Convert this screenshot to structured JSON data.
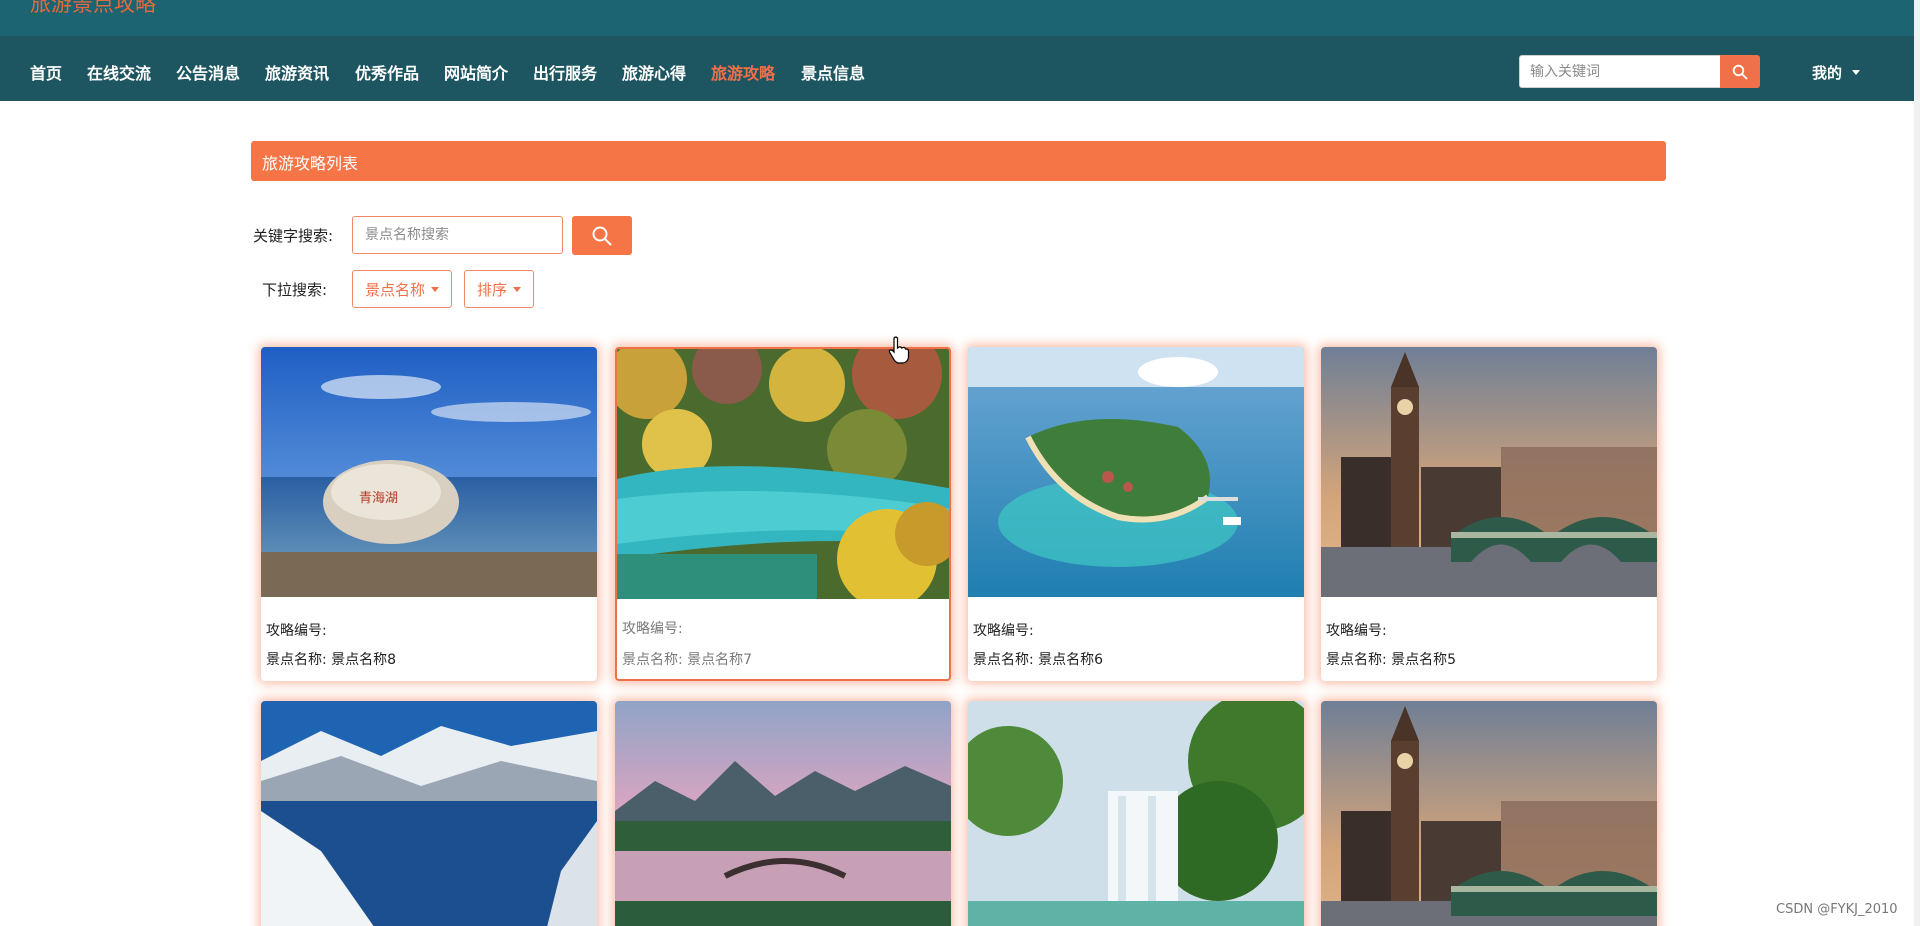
{
  "site": {
    "title": "旅游景点攻略"
  },
  "nav": {
    "items": [
      {
        "label": "首页"
      },
      {
        "label": "在线交流"
      },
      {
        "label": "公告消息"
      },
      {
        "label": "旅游资讯"
      },
      {
        "label": "优秀作品"
      },
      {
        "label": "网站简介"
      },
      {
        "label": "出行服务"
      },
      {
        "label": "旅游心得"
      },
      {
        "label": "旅游攻略",
        "active": true
      },
      {
        "label": "景点信息"
      }
    ],
    "search_placeholder": "输入关键词",
    "user_menu": "我的"
  },
  "page": {
    "title": "旅游攻略列表",
    "keyword_label": "关键字搜索:",
    "keyword_placeholder": "景点名称搜索",
    "dropdown_label": "下拉搜索:",
    "dropdowns": [
      {
        "label": "景点名称"
      },
      {
        "label": "排序"
      }
    ]
  },
  "cards": [
    {
      "scene": "lake-rock",
      "id_label": "攻略编号:",
      "name_label": "景点名称:",
      "name": "景点名称8"
    },
    {
      "scene": "autumn-forest-lake",
      "id_label": "攻略编号:",
      "name_label": "景点名称:",
      "name": "景点名称7"
    },
    {
      "scene": "tropical-island",
      "id_label": "攻略编号:",
      "name_label": "景点名称:",
      "name": "景点名称6"
    },
    {
      "scene": "london-big-ben",
      "id_label": "攻略编号:",
      "name_label": "景点名称:",
      "name": "景点名称5"
    },
    {
      "scene": "snow-mountain-lake"
    },
    {
      "scene": "sunset-bridge"
    },
    {
      "scene": "waterfall"
    },
    {
      "scene": "london-big-ben"
    }
  ],
  "watermark": "CSDN @FYKJ_2010",
  "colors": {
    "topbar": "#1c6472",
    "navbar": "#1d5561",
    "accent": "#f57547"
  }
}
